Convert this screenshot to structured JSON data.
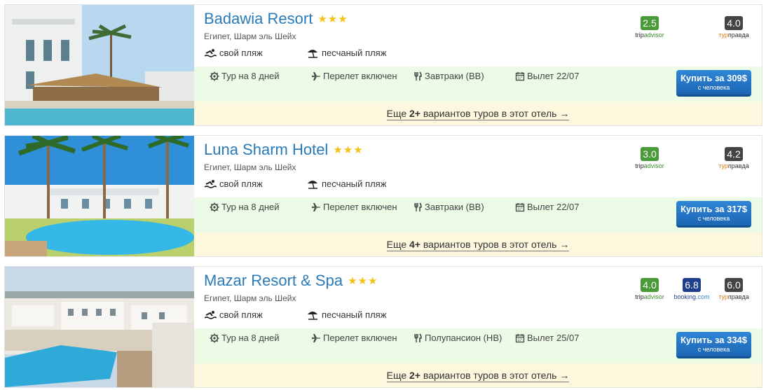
{
  "hotels": [
    {
      "name": "Badawia Resort",
      "stars": 3,
      "location": "Египет, Шарм эль Шейх",
      "features": [
        "свой пляж",
        "песчаный пляж"
      ],
      "ratings": [
        {
          "source": "tripadvisor",
          "part_a": "trip",
          "part_b": "advisor",
          "score": "2.5",
          "color": "#4a9a3a"
        },
        {
          "source": "turpravda",
          "part_a": "тур",
          "part_b": "правда",
          "score": "4.0",
          "color": "#444444"
        }
      ],
      "offer": {
        "duration": "Тур на 8 дней",
        "flight": "Перелет включен",
        "meal": "Завтраки (BB)",
        "departure": "Вылет 22/07",
        "buy_label": "Купить за 309$",
        "buy_sub": "с человека"
      },
      "more": {
        "prefix": "Еще ",
        "count": "2+",
        "suffix": " вариантов туров в этот отель →"
      }
    },
    {
      "name": "Luna Sharm Hotel",
      "stars": 3,
      "location": "Египет, Шарм эль Шейх",
      "features": [
        "свой пляж",
        "песчаный пляж"
      ],
      "ratings": [
        {
          "source": "tripadvisor",
          "part_a": "trip",
          "part_b": "advisor",
          "score": "3.0",
          "color": "#4a9a3a"
        },
        {
          "source": "turpravda",
          "part_a": "тур",
          "part_b": "правда",
          "score": "4.2",
          "color": "#444444"
        }
      ],
      "offer": {
        "duration": "Тур на 8 дней",
        "flight": "Перелет включен",
        "meal": "Завтраки (BB)",
        "departure": "Вылет 22/07",
        "buy_label": "Купить за 317$",
        "buy_sub": "с человека"
      },
      "more": {
        "prefix": "Еще ",
        "count": "4+",
        "suffix": " вариантов туров в этот отель →"
      }
    },
    {
      "name": "Mazar Resort & Spa",
      "stars": 3,
      "location": "Египет, Шарм эль Шейх",
      "features": [
        "свой пляж",
        "песчаный пляж"
      ],
      "ratings": [
        {
          "source": "tripadvisor",
          "part_a": "trip",
          "part_b": "advisor",
          "score": "4.0",
          "color": "#4a9a3a"
        },
        {
          "source": "booking",
          "part_a": "booking",
          "part_b": ".com",
          "score": "6.8",
          "color": "#1e3f8c"
        },
        {
          "source": "turpravda",
          "part_a": "тур",
          "part_b": "правда",
          "score": "6.0",
          "color": "#444444"
        }
      ],
      "offer": {
        "duration": "Тур на 8 дней",
        "flight": "Перелет включен",
        "meal": "Полупансион (HB)",
        "departure": "Вылет 25/07",
        "buy_label": "Купить за 334$",
        "buy_sub": "с человека"
      },
      "more": {
        "prefix": "Еще ",
        "count": "2+",
        "suffix": " вариантов туров в этот отель →"
      }
    }
  ],
  "icons": {
    "star": "star-icon",
    "private_beach": "swimmer-icon",
    "sandy_beach": "beach-umbrella-icon",
    "duration": "gear-icon",
    "flight": "airplane-icon",
    "meal": "cutlery-icon",
    "departure": "calendar-icon"
  },
  "colors": {
    "link": "#2a7ab8",
    "star": "#f3c214",
    "offer_bg": "#ecfbe6",
    "more_bg": "#fcf7dd",
    "button": "#1c66b4"
  }
}
